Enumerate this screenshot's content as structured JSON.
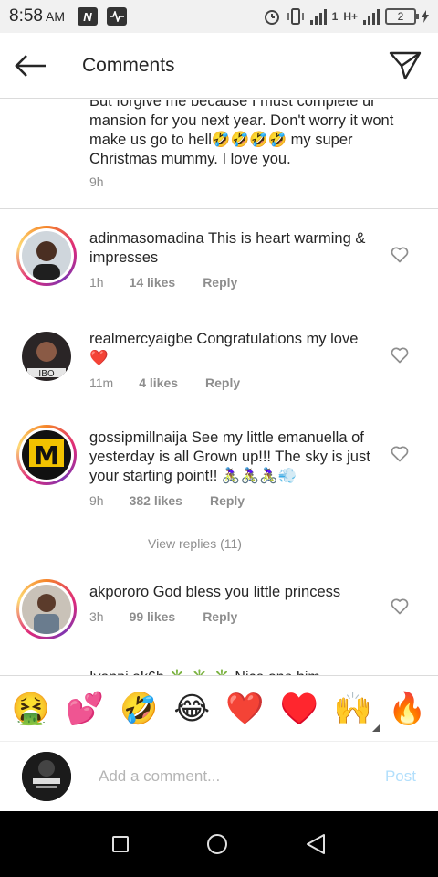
{
  "status": {
    "time": "8:58",
    "ampm": "AM",
    "lte_label": "1",
    "network_label": "H+",
    "battery": "2"
  },
  "header": {
    "title": "Comments"
  },
  "caption": {
    "text": "But forgive me because I must complete ur mansion for you next year. Don't worry it wont make us go to hell🤣🤣🤣🤣 my super Christmas mummy. I love you.",
    "time": "9h"
  },
  "comments": [
    {
      "username": "adinmasomadina",
      "text": "This is heart warming & impresses",
      "time": "1h",
      "likes": "14 likes",
      "reply": "Reply"
    },
    {
      "username": "realmercyaigbe",
      "text": "Congratulations my love ❤️",
      "time": "11m",
      "likes": "4 likes",
      "reply": "Reply"
    },
    {
      "username": "gossipmillnaija",
      "text": "See my little emanuella of yesterday is all Grown up!!! The sky is just your starting point!! 🚴🏾‍♀️🚴🏾‍♀️🚴🏾‍♀️💨",
      "time": "9h",
      "likes": "382 likes",
      "reply": "Reply"
    },
    {
      "username": "akpororo",
      "text": "God bless you little princess",
      "time": "3h",
      "likes": "99 likes",
      "reply": "Reply"
    }
  ],
  "view_replies": "View replies (11)",
  "partial_comment": "Ivanni.ak6b  ✳️ ✳️ ✳️  Nice one him",
  "emoji_bar": [
    "🤮",
    "💕",
    "🤣",
    "😂",
    "❤️",
    "♥️",
    "🙌",
    "🔥"
  ],
  "add_comment": {
    "placeholder": "Add a comment...",
    "post_label": "Post"
  },
  "colors": {
    "post_inactive": "#b2dffc",
    "meta_gray": "#8e8e8e",
    "heart_red": "#ed4956"
  }
}
